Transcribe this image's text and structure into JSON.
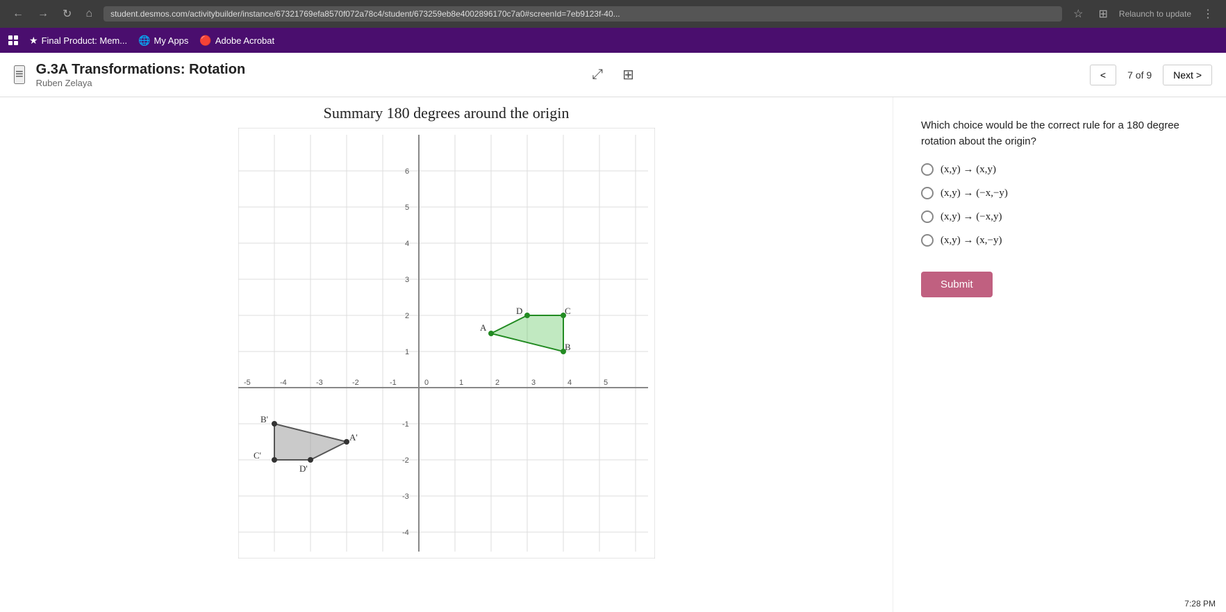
{
  "browser": {
    "url": "student.desmos.com/activitybuilder/instance/67321769efa8570f072a78c4/student/673259eb8e4002896170c7a0#screenId=7eb9123f-40...",
    "back_btn": "←",
    "forward_btn": "→",
    "refresh_btn": "↻",
    "home_btn": "⌂",
    "relaunch_label": "Relaunch to update",
    "star_icon": "☆",
    "extensions_icon": "⊞"
  },
  "bookmarks": {
    "grid_label": "",
    "items": [
      {
        "label": "Final Product: Mem...",
        "icon": "★"
      },
      {
        "label": "My Apps",
        "icon": "🌐"
      },
      {
        "label": "Adobe Acrobat",
        "icon": "🔴"
      }
    ]
  },
  "header": {
    "hamburger": "≡",
    "title": "G.3A Transformations: Rotation",
    "subtitle": "Ruben Zelaya",
    "expand_icon": "⤢",
    "grid_icon": "⊞",
    "prev_label": "<",
    "page_indicator": "7 of 9",
    "next_label": "Next >"
  },
  "content": {
    "section_title": "Summary 180 degrees around the origin",
    "question": "Which choice would be the correct rule for a 180 degree rotation about the origin?",
    "options": [
      {
        "id": "opt1",
        "text": "(x,y) → (x,y)"
      },
      {
        "id": "opt2",
        "text": "(x,y) → (−x,−y)"
      },
      {
        "id": "opt3",
        "text": "(x,y) → (−x,y)"
      },
      {
        "id": "opt4",
        "text": "(x,y) → (x,−y)"
      }
    ],
    "submit_label": "Submit"
  },
  "time": "7:28 PM"
}
